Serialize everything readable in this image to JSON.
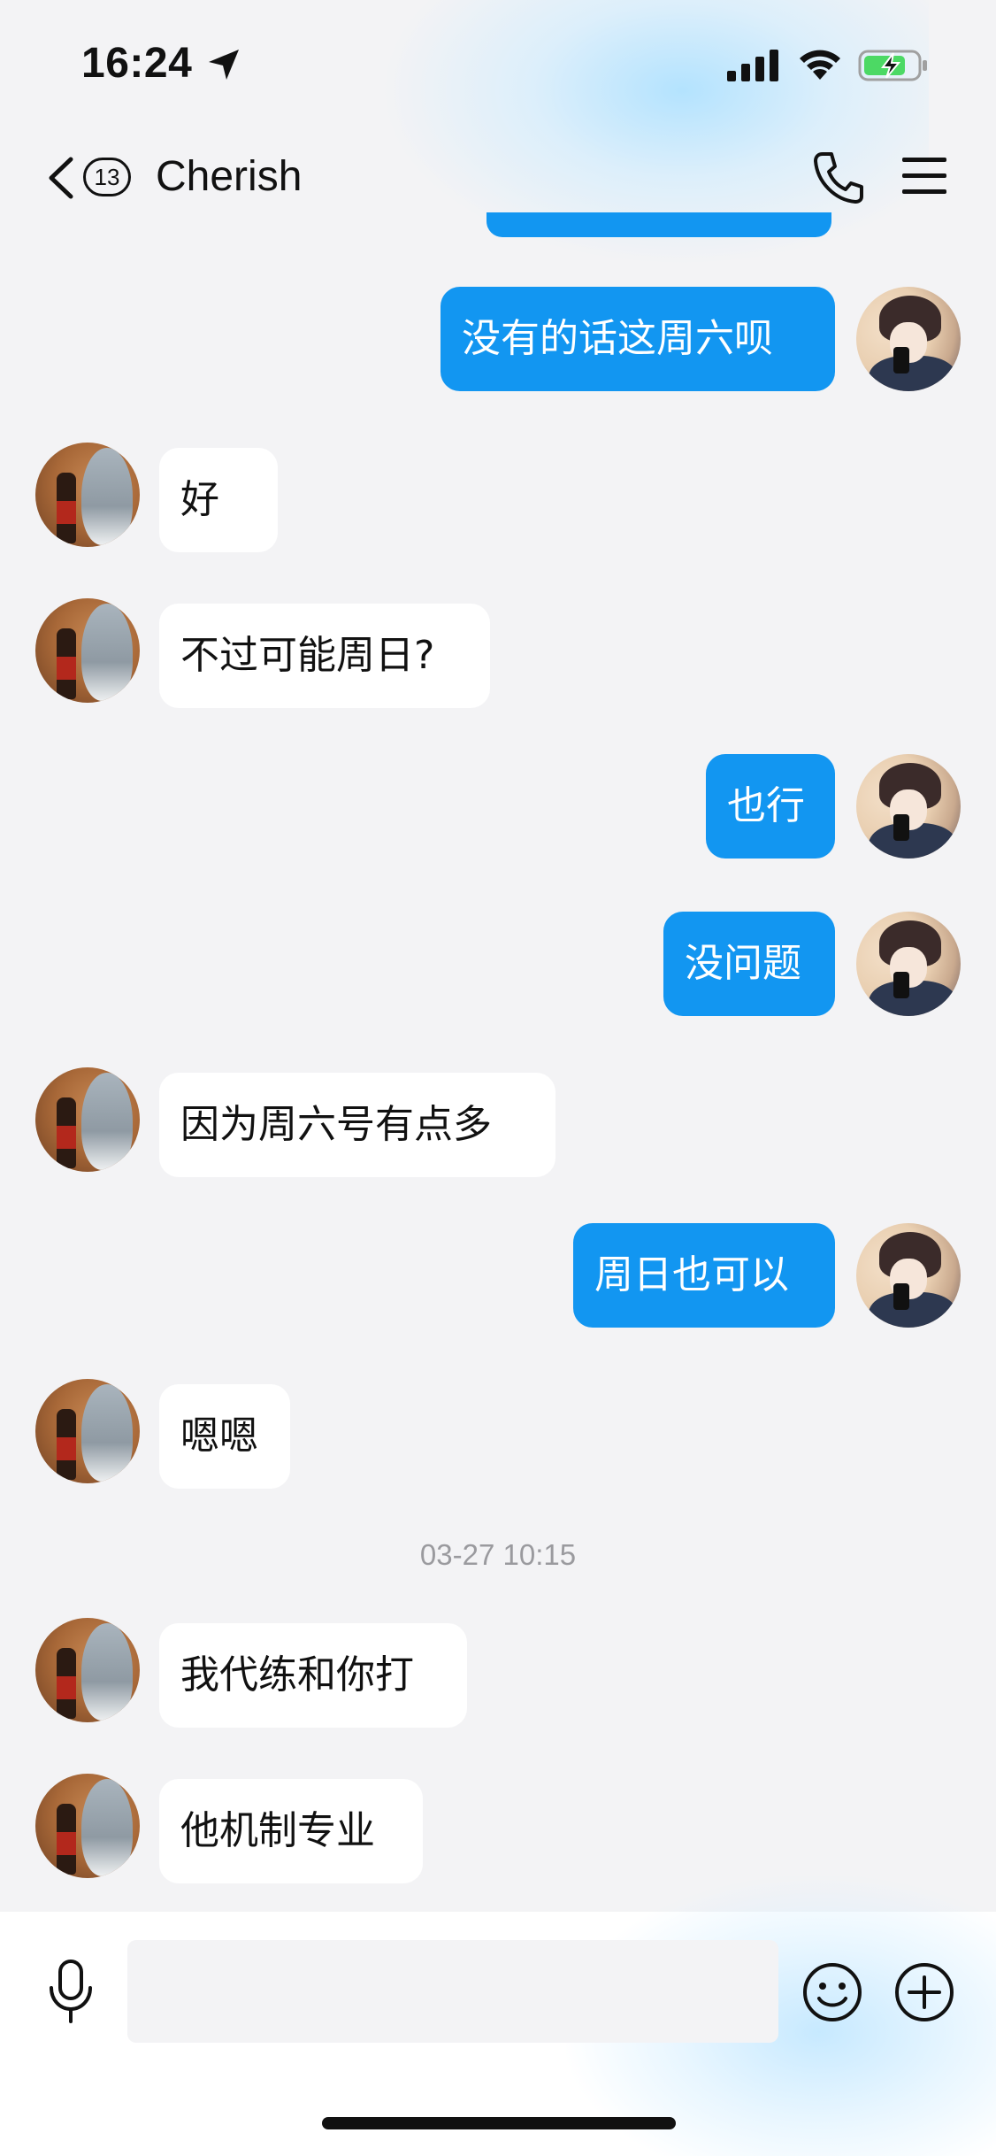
{
  "status_bar": {
    "time": "16:24"
  },
  "header": {
    "unread_count": "13",
    "contact_name": "Cherish"
  },
  "messages": [
    {
      "from": "self",
      "text": "没有的话这周六呗"
    },
    {
      "from": "other",
      "text": "好"
    },
    {
      "from": "other",
      "text": "不过可能周日?"
    },
    {
      "from": "self",
      "text": "也行"
    },
    {
      "from": "self",
      "text": "没问题"
    },
    {
      "from": "other",
      "text": "因为周六号有点多"
    },
    {
      "from": "self",
      "text": "周日也可以"
    },
    {
      "from": "other",
      "text": "嗯嗯"
    },
    {
      "from": "other",
      "text": "我代练和你打"
    },
    {
      "from": "other",
      "text": "他机制专业"
    }
  ],
  "timestamp": "03-27 10:15",
  "input": {
    "value": "",
    "placeholder": ""
  },
  "colors": {
    "self_bubble": "#1296f1",
    "other_bubble": "#ffffff",
    "background": "#f3f3f5"
  },
  "icons": [
    "location-arrow-icon",
    "signal-icon",
    "wifi-icon",
    "battery-charging-icon",
    "back-chevron-icon",
    "phone-call-icon",
    "menu-icon",
    "microphone-icon",
    "emoji-icon",
    "plus-icon"
  ]
}
